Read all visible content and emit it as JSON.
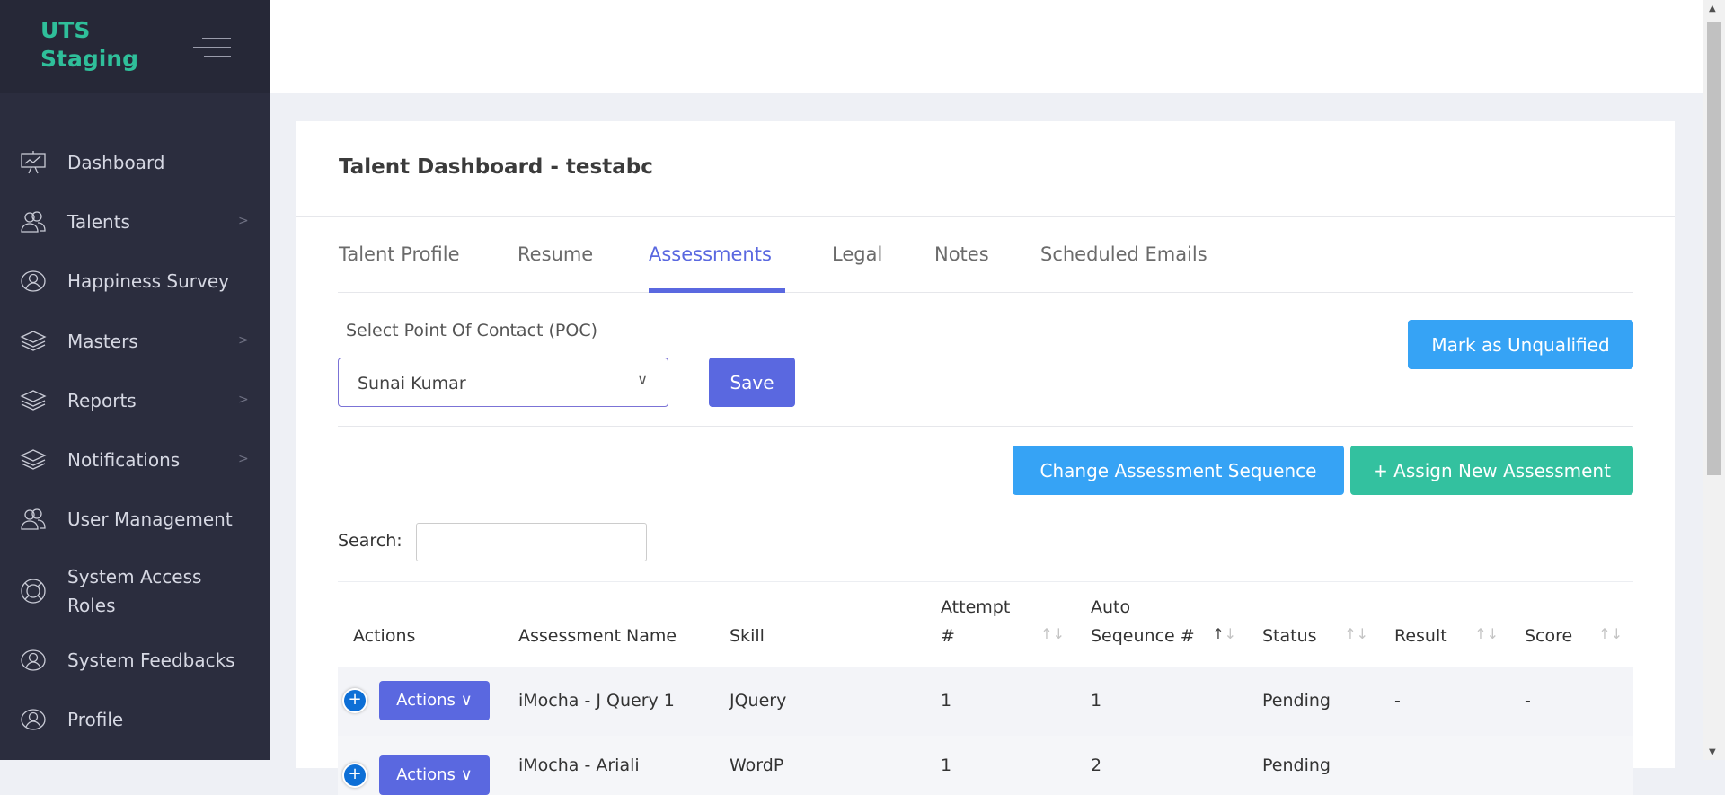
{
  "app": {
    "logo": "UTS Staging"
  },
  "sidebar": {
    "items": [
      {
        "label": "Dashboard",
        "icon": "presentation-chart-icon",
        "chevron": false
      },
      {
        "label": "Talents",
        "icon": "users-icon",
        "chevron": true
      },
      {
        "label": "Happiness Survey",
        "icon": "user-circle-icon",
        "chevron": false
      },
      {
        "label": "Masters",
        "icon": "layers-icon",
        "chevron": true
      },
      {
        "label": "Reports",
        "icon": "layers-icon",
        "chevron": true
      },
      {
        "label": "Notifications",
        "icon": "layers-icon",
        "chevron": true
      },
      {
        "label": "User Management",
        "icon": "users-icon",
        "chevron": false
      },
      {
        "label": "System Access Roles",
        "icon": "lifebuoy-icon",
        "chevron": false
      },
      {
        "label": "System Feedbacks",
        "icon": "user-circle-icon",
        "chevron": false
      },
      {
        "label": "Profile",
        "icon": "user-circle-icon",
        "chevron": false
      }
    ]
  },
  "page": {
    "title": "Talent Dashboard - testabc"
  },
  "tabs": [
    "Talent Profile",
    "Resume",
    "Assessments",
    "Legal",
    "Notes",
    "Scheduled Emails"
  ],
  "active_tab": "Assessments",
  "poc": {
    "label": "Select Point Of Contact (POC)",
    "selected": "Sunai Kumar",
    "save": "Save"
  },
  "buttons": {
    "unqualified": "Mark as Unqualified",
    "change_sequence": "Change Assessment Sequence",
    "assign": "+ Assign New Assessment"
  },
  "search": {
    "label": "Search:",
    "value": ""
  },
  "table": {
    "headers": [
      "Actions",
      "Assessment Name",
      "Skill",
      "Attempt #",
      "Auto Seqeunce #",
      "Status",
      "Result",
      "Score"
    ],
    "rows": [
      {
        "action": "Actions",
        "name": "iMocha - J Query 1",
        "skill": "JQuery",
        "attempt": "1",
        "seq": "1",
        "status": "Pending",
        "result": "-",
        "score": "-"
      },
      {
        "action": "Actions",
        "name": "iMocha - Ariali",
        "skill": "WordP",
        "attempt": "1",
        "seq": "2",
        "status": "Pending",
        "result": "",
        "score": ""
      }
    ]
  },
  "colors": {
    "accent": "#5a68e0",
    "blue": "#36a3f5",
    "green": "#33c19f",
    "sidebar": "#2b2d3e"
  }
}
